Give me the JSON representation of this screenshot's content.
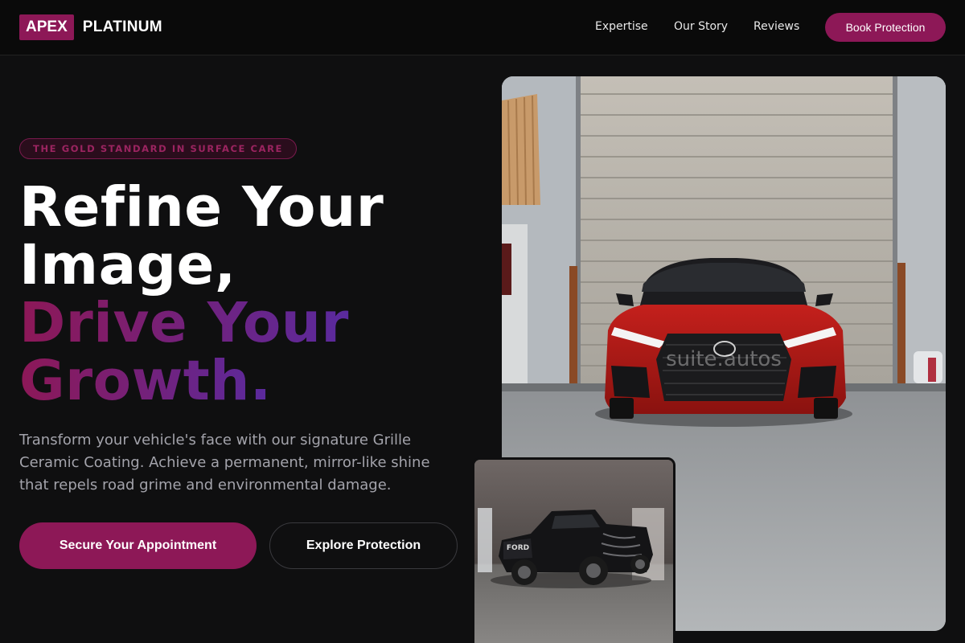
{
  "header": {
    "logo_box": "APEX",
    "logo_text": "PLATINUM",
    "nav": [
      {
        "label": "Expertise"
      },
      {
        "label": "Our Story"
      },
      {
        "label": "Reviews"
      }
    ],
    "book_label": "Book Protection"
  },
  "hero": {
    "badge": "THE GOLD STANDARD IN SURFACE CARE",
    "headline_line1": "Refine Your",
    "headline_line2": "Image,",
    "headline_line3": "Drive Your",
    "headline_line4": "Growth.",
    "description": "Transform your vehicle's face with our signature Grille Ceramic Coating. Achieve a permanent, mirror-like shine that repels road grime and environmental damage.",
    "cta_primary": "Secure Your Appointment",
    "cta_secondary": "Explore Protection"
  },
  "images": {
    "main_watermark": "suite.autos",
    "sub_plate": "FORD"
  },
  "colors": {
    "accent": "#8d1857",
    "gradient_end": "#5a2a9e",
    "background": "#0f0f10",
    "header_bg": "#0a0a0a"
  }
}
